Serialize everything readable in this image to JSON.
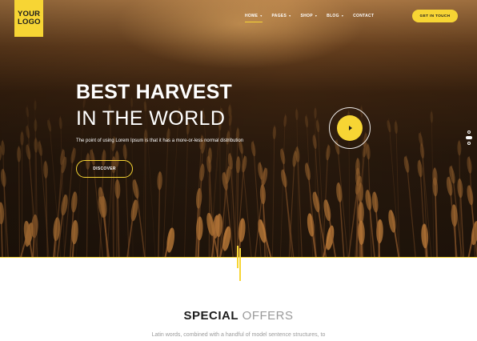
{
  "brand": {
    "logo_line1": "YOUR",
    "logo_line2": "LOGO"
  },
  "nav": {
    "items": [
      {
        "label": "HOME",
        "has_dropdown": true,
        "active": true
      },
      {
        "label": "PAGES",
        "has_dropdown": true,
        "active": false
      },
      {
        "label": "SHOP",
        "has_dropdown": true,
        "active": false
      },
      {
        "label": "BLOG",
        "has_dropdown": true,
        "active": false
      },
      {
        "label": "CONTACT",
        "has_dropdown": false,
        "active": false
      }
    ],
    "chevron_icon": "chevron-down-icon",
    "cta_label": "GET IN TOUCH"
  },
  "hero": {
    "headline": "BEST HARVEST",
    "subheadline": "IN THE WORLD",
    "description": "The point of using Lorem Ipsum is that it has a more-or-less normal distribution",
    "button_label": "DISCOVER",
    "play_icon": "play-icon",
    "slider_dots": {
      "count": 3,
      "active_index": 1
    }
  },
  "section": {
    "title_bold": "SPECIAL",
    "title_light": "OFFERS",
    "text": "Latin words, combined with a handful of model sentence structures, to"
  },
  "colors": {
    "accent": "#f7d534",
    "dark": "#1d1d1d",
    "muted": "#9a9a9a",
    "white": "#ffffff"
  }
}
